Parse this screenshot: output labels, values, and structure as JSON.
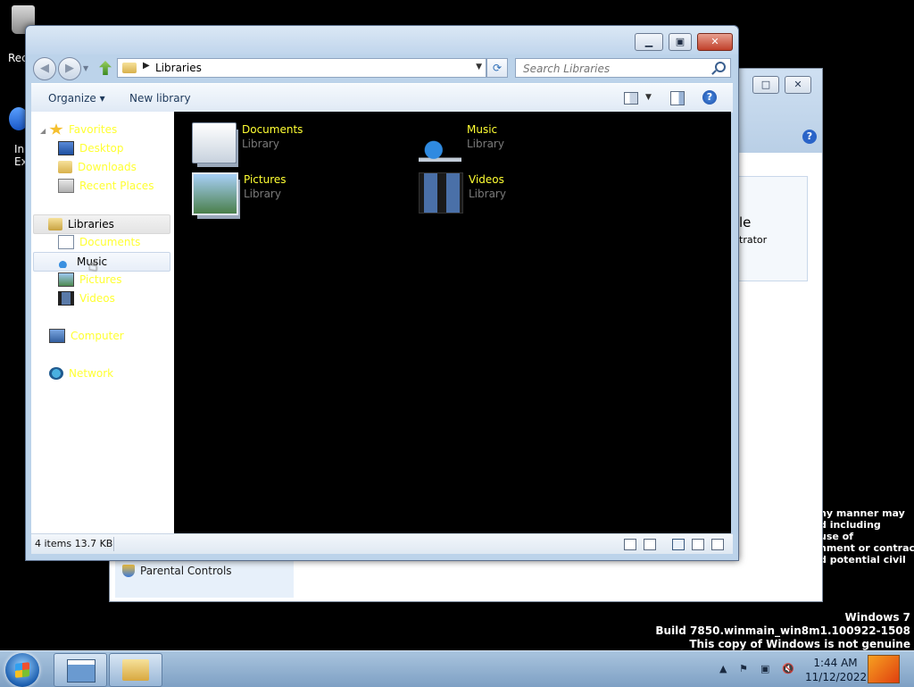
{
  "desktop": {
    "recycle_label": "Rec",
    "ie_label_1": "In",
    "ie_label_2": "Ex",
    "legal_lines": [
      "ny manner may",
      "d including",
      "use of",
      "nment or contract",
      "d potential civil"
    ],
    "watermark": [
      "Windows 7",
      "Build 7850.winmain_win8m1.100922-1508",
      "This copy of Windows is not genuine"
    ]
  },
  "background_window": {
    "panel_big": "le",
    "panel_sub": "trator",
    "parental_controls": "Parental Controls"
  },
  "explorer": {
    "breadcrumb": "Libraries",
    "search_placeholder": "Search Libraries",
    "cmd": {
      "organize": "Organize ▾",
      "new_library": "New library"
    },
    "nav": {
      "favorites": "Favorites",
      "desktop": "Desktop",
      "downloads": "Downloads",
      "recent": "Recent Places",
      "libraries": "Libraries",
      "documents": "Documents",
      "music": "Music",
      "pictures": "Pictures",
      "videos": "Videos",
      "computer": "Computer",
      "network": "Network"
    },
    "libraries": [
      {
        "name": "Documents",
        "type": "Library",
        "icon": "documents-library-icon"
      },
      {
        "name": "Music",
        "type": "Library",
        "icon": "music-library-icon"
      },
      {
        "name": "Pictures",
        "type": "Library",
        "icon": "pictures-library-icon"
      },
      {
        "name": "Videos",
        "type": "Library",
        "icon": "videos-library-icon"
      }
    ],
    "status": "4 items  13.7 KB"
  },
  "taskbar": {
    "time": "1:44 AM",
    "date": "11/12/2022"
  },
  "colors": {
    "accent_text": "#ffff33",
    "content_bg": "#000000"
  }
}
